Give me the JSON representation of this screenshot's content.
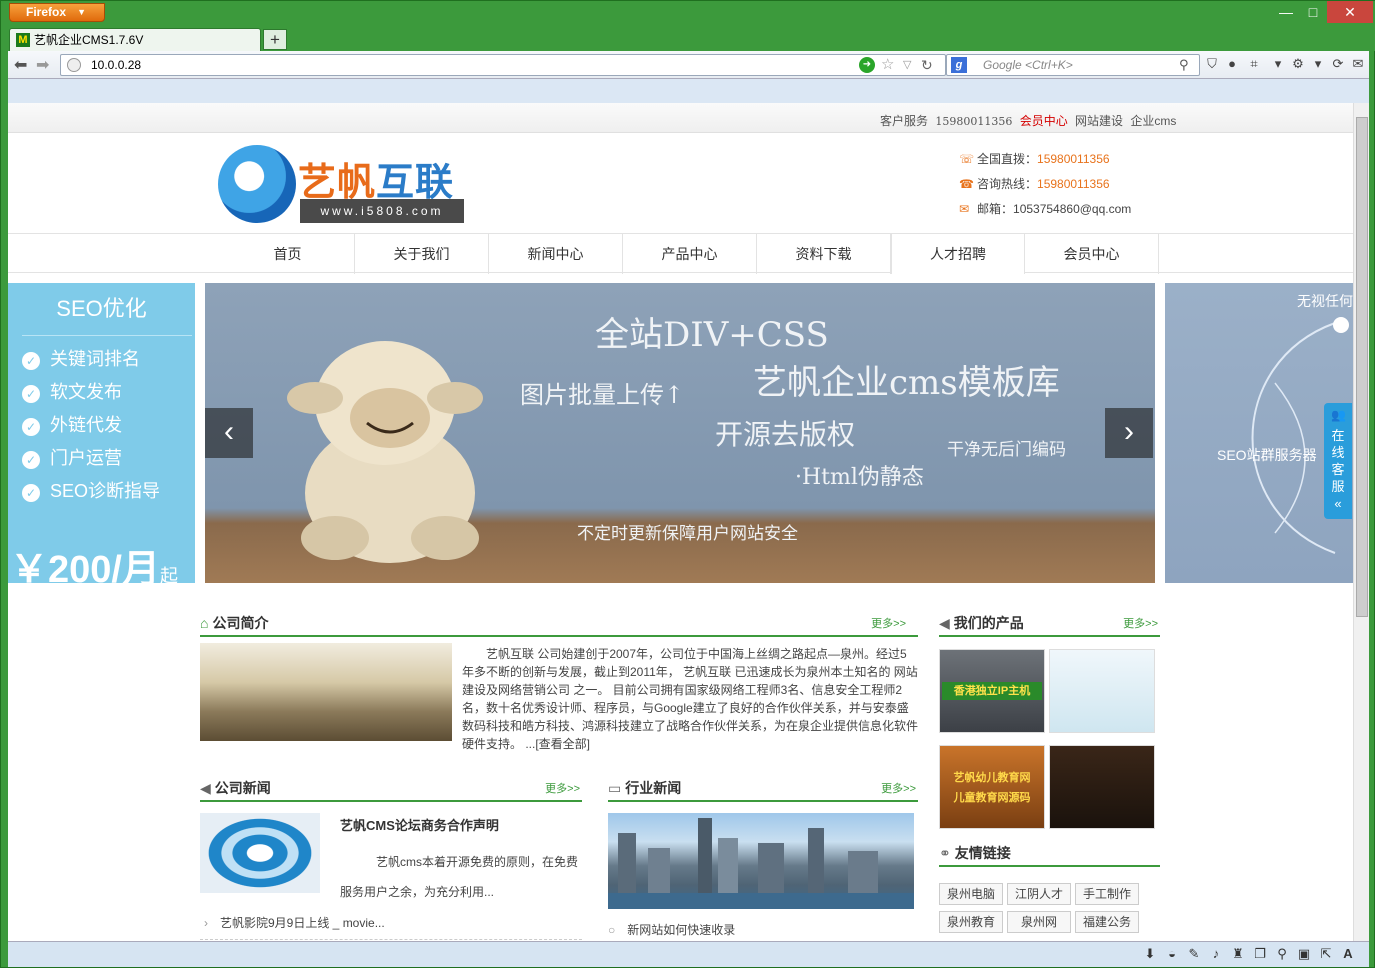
{
  "browser": {
    "menu_label": "Firefox",
    "tab_title": "艺帆企业CMS1.7.6V",
    "tab_icon": "M",
    "url": "10.0.0.28",
    "search_placeholder": "Google <Ctrl+K>",
    "window_minimize": "—",
    "window_maximize": "□",
    "window_close": "✕"
  },
  "top_links": {
    "service": "客户服务",
    "phone": "15980011356",
    "member": "会员中心",
    "build": "网站建设",
    "cms": "企业cms"
  },
  "logo": {
    "name_part1": "艺帆",
    "name_part2": "互联",
    "url": "www.i5808.com"
  },
  "contact": {
    "direct_label": "全国直拨：",
    "direct_value": "15980011356",
    "hotline_label": "咨询热线：",
    "hotline_value": "15980011356",
    "email_label": "邮箱：",
    "email_value": "1053754860@qq.com"
  },
  "nav": [
    "首页",
    "关于我们",
    "新闻中心",
    "产品中心",
    "资料下载",
    "人才招聘",
    "会员中心"
  ],
  "seo": {
    "title": "SEO优化",
    "items": [
      "关键词排名",
      "软文发布",
      "外链代发",
      "门户运营",
      "SEO诊断指导"
    ],
    "price": "￥200/月",
    "price_suffix": "起"
  },
  "banner": {
    "line1": "全站DIV+CSS",
    "line2": "图片批量上传↑",
    "line3": "艺帆企业cms模板库",
    "line4": "开源去版权",
    "line5": "干净无后门编码",
    "line6": "·Html伪静态",
    "line7": "不定时更新保障用户网站安全",
    "prev": "‹",
    "next": "›"
  },
  "banner2": {
    "text1": "无视任何",
    "text2": "SEO站群服务器"
  },
  "float_service": {
    "label": "在线客服",
    "arrow": "«"
  },
  "about": {
    "title": "公司简介",
    "more": "更多>>",
    "text": "艺帆互联 公司始建创于2007年，公司位于中国海上丝绸之路起点—泉州。经过5年多不断的创新与发展，截止到2011年， 艺帆互联 已迅速成长为泉州本土知名的 网站建设及网络营销公司 之一。 目前公司拥有国家级网络工程师3名、信息安全工程师2名，数十名优秀设计师、程序员，与Google建立了良好的合作伙伴关系，并与安泰盛数码科技和皓方科技、鸿源科技建立了战略合作伙伴关系，为在泉企业提供信息化软件硬件支持。 ...[查看全部]"
  },
  "products": {
    "title": "我们的产品",
    "more": "更多>>",
    "p1": "香港独立IP主机",
    "p3a": "艺帆幼儿教育网",
    "p3b": "儿童教育网源码"
  },
  "company_news": {
    "title": "公司新闻",
    "more": "更多>>",
    "headline": "艺帆CMS论坛商务合作声明",
    "desc": "艺帆cms本着开源免费的原则，在免费服务用户之余，为充分利用...",
    "item1": "艺帆影院9月9日上线 _ movie..."
  },
  "industry_news": {
    "title": "行业新闻",
    "more": "更多>>",
    "item1": "新网站如何快速收录"
  },
  "links": {
    "title": "友情链接",
    "items": [
      "泉州电脑",
      "江阴人才",
      "手工制作",
      "泉州教育",
      "泉州网",
      "福建公务"
    ]
  }
}
